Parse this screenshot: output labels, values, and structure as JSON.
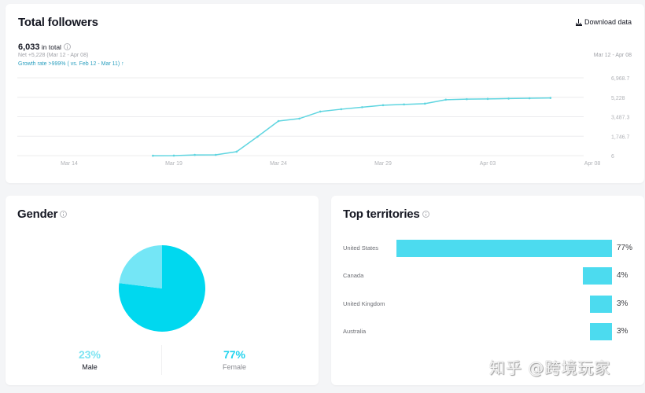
{
  "followers_card": {
    "title": "Total followers",
    "download_label": "Download data",
    "total_value": "6,033",
    "total_suffix": " in total",
    "net_text": "Net +5,228 (Mar 12 - Apr 08)",
    "growth_text": "Growth rate >999% ( vs. Feb 12 - Mar 11) ↑",
    "date_range": "Mar 12 - Apr 08"
  },
  "gender_card": {
    "title": "Gender",
    "male_pct": "23%",
    "male_label": "Male",
    "female_pct": "77%",
    "female_label": "Female"
  },
  "territories_card": {
    "title": "Top territories",
    "items": [
      {
        "label": "United States",
        "pct": "77%"
      },
      {
        "label": "Canada",
        "pct": "4%"
      },
      {
        "label": "United Kingdom",
        "pct": "3%"
      },
      {
        "label": "Australia",
        "pct": "3%"
      }
    ]
  },
  "colors": {
    "line": "#5fd5e0",
    "male": "#74e6f6",
    "female": "#00d8ef",
    "bar": "#4cdbef"
  },
  "watermark": "知乎 @跨境玩家",
  "chart_data": [
    {
      "type": "line",
      "title": "Total followers",
      "x": [
        "Mar 18",
        "Mar 19",
        "Mar 20",
        "Mar 21",
        "Mar 22",
        "Mar 23",
        "Mar 24",
        "Mar 25",
        "Mar 26",
        "Mar 27",
        "Mar 28",
        "Mar 29",
        "Mar 30",
        "Mar 31",
        "Apr 01",
        "Apr 02",
        "Apr 03",
        "Apr 04",
        "Apr 05",
        "Apr 06"
      ],
      "series": [
        {
          "name": "Total followers",
          "values": [
            0,
            10,
            70,
            75,
            360,
            1700,
            3100,
            3320,
            3950,
            4160,
            4340,
            4520,
            4590,
            4660,
            5010,
            5060,
            5080,
            5110,
            5140,
            5170
          ]
        }
      ],
      "x_domain": [
        "Mar 12",
        "Apr 08"
      ],
      "x_ticks": [
        "Mar 14",
        "Mar 19",
        "Mar 24",
        "Mar 29",
        "Apr 03",
        "Apr 08"
      ],
      "y_ticks": [
        "6,968.7",
        "5,228",
        "3,487.3",
        "1,746.7",
        "6"
      ],
      "ylim": [
        6,
        6968.7
      ],
      "grid": true
    },
    {
      "type": "pie",
      "title": "Gender",
      "categories": [
        "Male",
        "Female"
      ],
      "values": [
        23,
        77
      ]
    },
    {
      "type": "bar",
      "title": "Top territories",
      "orientation": "horizontal",
      "categories": [
        "United States",
        "Canada",
        "United Kingdom",
        "Australia"
      ],
      "values": [
        77,
        4,
        3,
        3
      ],
      "unit": "%"
    }
  ]
}
